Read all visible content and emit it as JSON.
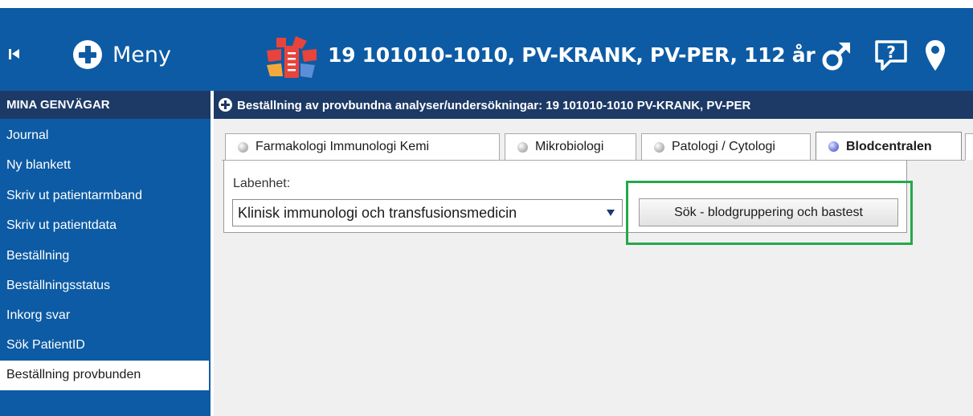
{
  "header": {
    "menu_label": "Meny",
    "patient_info": "19 101010-1010,  PV-KRANK, PV-PER,  112 år",
    "icons": [
      "collapse-icon",
      "plus-circle-icon",
      "patient-logo-icon",
      "male-icon",
      "question-bubble-icon",
      "location-pin-icon"
    ]
  },
  "sidebar": {
    "title": "MINA GENVÄGAR",
    "items": [
      {
        "label": "Journal"
      },
      {
        "label": "Ny blankett"
      },
      {
        "label": "Skriv ut patientarmband"
      },
      {
        "label": "Skriv ut patientdata"
      },
      {
        "label": "Beställning"
      },
      {
        "label": "Beställningsstatus"
      },
      {
        "label": "Inkorg svar"
      },
      {
        "label": "Sök PatientID"
      },
      {
        "label": "Beställning provbunden"
      }
    ],
    "active_item": "Beställning provbunden"
  },
  "main": {
    "title": "Beställning av provbundna analyser/undersökningar: 19 101010-1010 PV-KRANK, PV-PER",
    "tabs": [
      {
        "label": "Farmakologi Immunologi Kemi"
      },
      {
        "label": "Mikrobiologi"
      },
      {
        "label": "Patologi / Cytologi"
      },
      {
        "label": "Blodcentralen"
      }
    ],
    "active_tab": "Blodcentralen",
    "form": {
      "labenhet_label": "Labenhet:",
      "labenhet_value": "Klinisk immunologi och transfusionsmedicin",
      "search_button": "Sök - blodgruppering och bastest"
    }
  },
  "colors": {
    "header_blue": "#0d5ba4",
    "title_bar_navy": "#1d3a66",
    "highlight_green": "#25a84a"
  }
}
